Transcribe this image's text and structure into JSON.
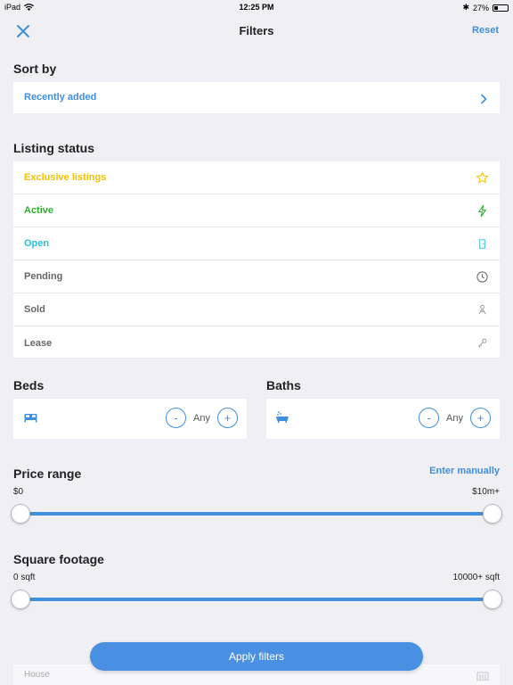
{
  "status_bar": {
    "device": "iPad",
    "time": "12:25 PM",
    "battery": "27%",
    "battery_level": 0.27
  },
  "nav": {
    "title": "Filters",
    "reset_label": "Reset"
  },
  "sort": {
    "title": "Sort by",
    "value": "Recently added"
  },
  "listing_status": {
    "title": "Listing status",
    "items": [
      {
        "label": "Exclusive listings",
        "color": "#f5c000",
        "icon": "star-icon"
      },
      {
        "label": "Active",
        "color": "#2fae2f",
        "icon": "lightning-icon"
      },
      {
        "label": "Open",
        "color": "#2bbfd6",
        "icon": "door-icon"
      },
      {
        "label": "Pending",
        "color": "#666666",
        "icon": "clock-icon"
      },
      {
        "label": "Sold",
        "color": "#666666",
        "icon": "person-icon"
      },
      {
        "label": "Lease",
        "color": "#666666",
        "icon": "key-icon"
      }
    ]
  },
  "beds": {
    "title": "Beds",
    "icon": "bed-icon",
    "value": "Any",
    "minus": "-",
    "plus": "+"
  },
  "baths": {
    "title": "Baths",
    "icon": "bathtub-icon",
    "value": "Any",
    "minus": "-",
    "plus": "+"
  },
  "price": {
    "title": "Price range",
    "manual_label": "Enter manually",
    "min_label": "$0",
    "max_label": "$10m+",
    "range": [
      0,
      1
    ]
  },
  "sqft": {
    "title": "Square footage",
    "min_label": "0 sqft",
    "max_label": "10000+ sqft",
    "range": [
      0,
      1
    ]
  },
  "property_type": {
    "first_item": "House"
  },
  "apply_label": "Apply filters",
  "accent": "#3f8fdc"
}
